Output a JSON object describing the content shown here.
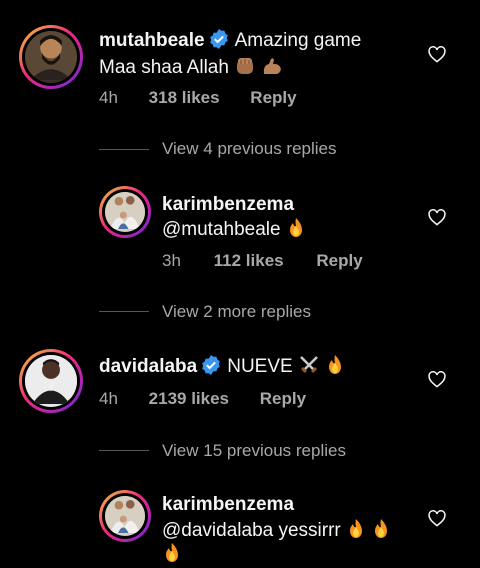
{
  "comments": [
    {
      "username": "mutahbeale",
      "verified": true,
      "text_line1": "Amazing game",
      "text_line2": "Maa shaa Allah",
      "time": "4h",
      "likes": "318 likes",
      "reply": "Reply"
    },
    {
      "username": "karimbenzema",
      "verified": false,
      "text": "@mutahbeale",
      "time": "3h",
      "likes": "112 likes",
      "reply": "Reply"
    },
    {
      "username": "davidalaba",
      "verified": true,
      "text": "NUEVE",
      "time": "4h",
      "likes": "2139 likes",
      "reply": "Reply"
    },
    {
      "username": "karimbenzema",
      "verified": false,
      "text": "@davidalaba yessirrr"
    }
  ],
  "view_replies": [
    "View 4 previous replies",
    "View 2 more replies",
    "View 15 previous replies"
  ],
  "icons": {
    "verified": "verified-badge-icon",
    "like": "heart-outline-icon",
    "fire": "fire-emoji",
    "strong": "flexed-biceps-emoji",
    "fist": "raised-fist-emoji",
    "swords": "crossed-swords-emoji"
  },
  "colors": {
    "background": "#000000",
    "text": "#f5f5f5",
    "meta": "#a8a8a8",
    "verified": "#3897f0"
  }
}
